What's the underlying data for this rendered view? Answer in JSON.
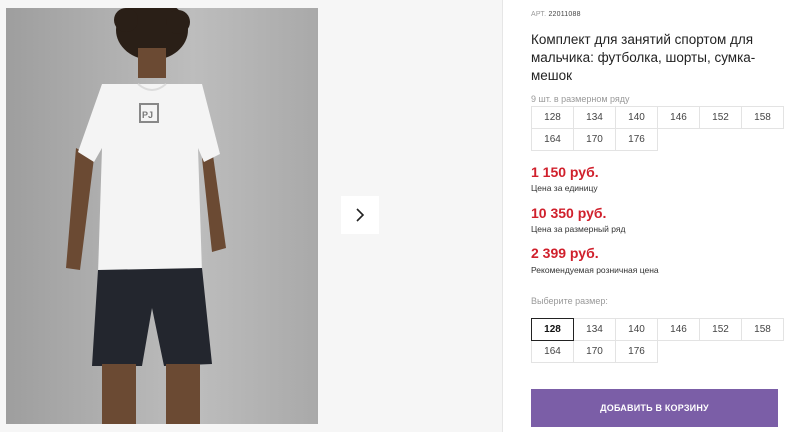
{
  "gallery": {
    "photo_alt": "boy-in-sport-set"
  },
  "product": {
    "article_label": "АРТ.",
    "article_number": "22011088",
    "title": "Комплект для занятий спортом для мальчика: футболка, шорты, сумка-мешок",
    "range_caption": "9 шт. в размерном ряду",
    "range_sizes": [
      "128",
      "134",
      "140",
      "146",
      "152",
      "158",
      "164",
      "170",
      "176"
    ],
    "prices": [
      {
        "value": "1 150 руб.",
        "label": "Цена за единицу"
      },
      {
        "value": "10 350 руб.",
        "label": "Цена за размерный ряд"
      },
      {
        "value": "2 399 руб.",
        "label": "Рекомендуемая розничная цена"
      }
    ],
    "choose_caption": "Выберите размер:",
    "choose_sizes": [
      "128",
      "134",
      "140",
      "146",
      "152",
      "158",
      "164",
      "170",
      "176"
    ],
    "selected_size": "128",
    "cart_button_label": "ДОБАВИТЬ В КОРЗИНУ"
  },
  "colors": {
    "price": "#d0202c",
    "accent": "#7b5ea7"
  },
  "icons": {
    "next": "chevron-right-icon"
  }
}
